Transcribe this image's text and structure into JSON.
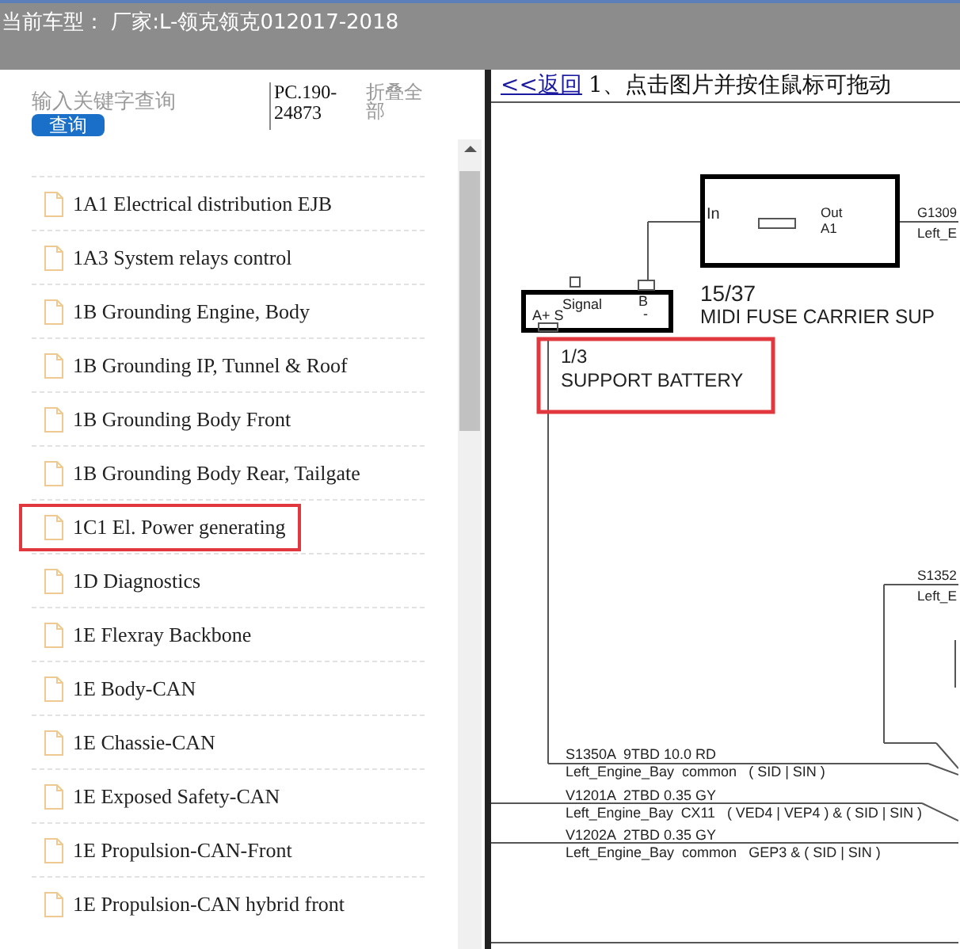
{
  "header": {
    "title": "当前车型：  厂家:L-领克领克012017-2018"
  },
  "search": {
    "placeholder": "输入关键字查询",
    "button": "查询"
  },
  "code": "PC.190-24873",
  "collapse_all": "折叠全部",
  "items": [
    {
      "label": "1A1 Electrical distribution EJB",
      "selected": false
    },
    {
      "label": "1A3 System relays control",
      "selected": false
    },
    {
      "label": "1B Grounding Engine, Body",
      "selected": false
    },
    {
      "label": "1B Grounding IP, Tunnel & Roof",
      "selected": false
    },
    {
      "label": "1B Grounding Body Front",
      "selected": false
    },
    {
      "label": "1B Grounding Body Rear, Tailgate",
      "selected": false
    },
    {
      "label": "1C1 El. Power generating",
      "selected": true
    },
    {
      "label": "1D Diagnostics",
      "selected": false
    },
    {
      "label": "1E Flexray Backbone",
      "selected": false
    },
    {
      "label": "1E Body-CAN",
      "selected": false
    },
    {
      "label": "1E Chassie-CAN",
      "selected": false
    },
    {
      "label": "1E Exposed Safety-CAN",
      "selected": false
    },
    {
      "label": "1E Propulsion-CAN-Front",
      "selected": false
    },
    {
      "label": "1E Propulsion-CAN hybrid front",
      "selected": false
    }
  ],
  "viewer": {
    "back_link": "<<返回",
    "instruction": "1、点击图片并按住鼠标可拖动",
    "diagram_labels": [
      "In",
      "Out",
      "A1",
      "G1309",
      "Left_E",
      "Signal",
      "A+ S",
      "B",
      "-",
      "15/37",
      "MIDI FUSE CARRIER SUP",
      "1/3",
      "SUPPORT BATTERY",
      "S1352",
      "Left_E",
      "S1350A  9TBD 10.0 RD",
      "Left_Engine_Bay  common   ( SID | SIN )",
      "V1201A  2TBD 0.35 GY",
      "Left_Engine_Bay  CX11   ( VED4 | VEP4 ) & ( SID | SIN )",
      "V1202A  2TBD 0.35 GY",
      "Left_Engine_Bay  common   GEP3 & ( SID | SIN )"
    ]
  }
}
